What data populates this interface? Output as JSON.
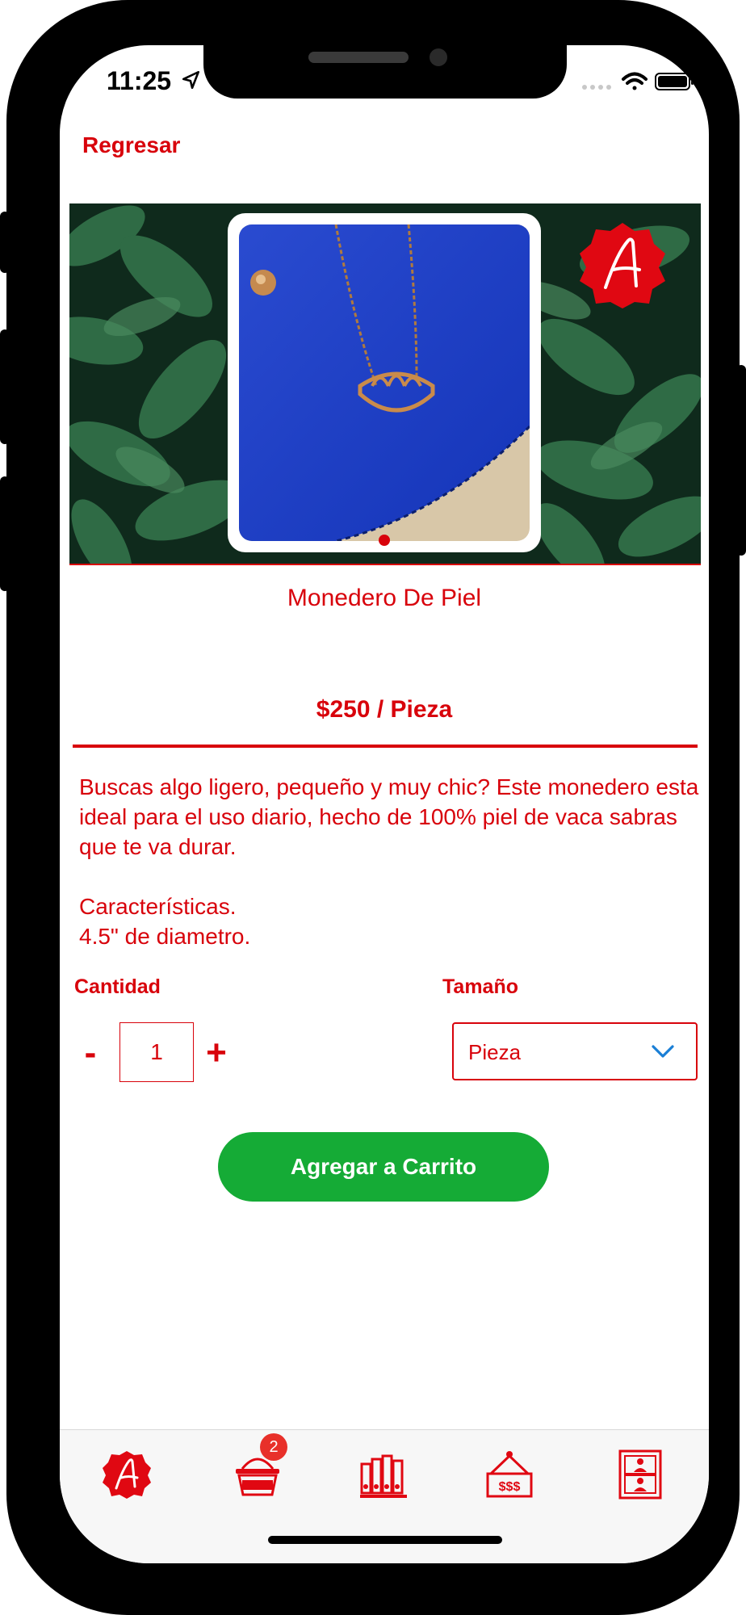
{
  "status_bar": {
    "time": "11:25"
  },
  "nav": {
    "back_label": "Regresar"
  },
  "product": {
    "title": "Monedero De Piel",
    "price": "$250 / Pieza",
    "description": [
      "Buscas algo ligero, pequeño y muy chic? Este monedero esta ideal para el uso diario, hecho de 100% piel de vaca sabras que te va durar.",
      "Características.",
      "4.5\" de diametro."
    ],
    "carousel": {
      "image_count": 1,
      "active_index": 0
    }
  },
  "quantity": {
    "label": "Cantidad",
    "minus": "-",
    "plus": "+",
    "value": "1"
  },
  "size": {
    "label": "Tamaño",
    "selected": "Pieza"
  },
  "actions": {
    "add_to_cart": "Agregar a Carrito"
  },
  "tab_bar": {
    "cart_badge": "2",
    "items": [
      {
        "icon": "brand-logo-icon"
      },
      {
        "icon": "shopping-basket-icon"
      },
      {
        "icon": "catalog-binders-icon"
      },
      {
        "icon": "price-sign-icon"
      },
      {
        "icon": "contacts-icon"
      }
    ]
  },
  "colors": {
    "accent": "#d8020b",
    "cta": "#15ab36",
    "badge": "#e8302a",
    "chevron": "#1a7fd6"
  }
}
